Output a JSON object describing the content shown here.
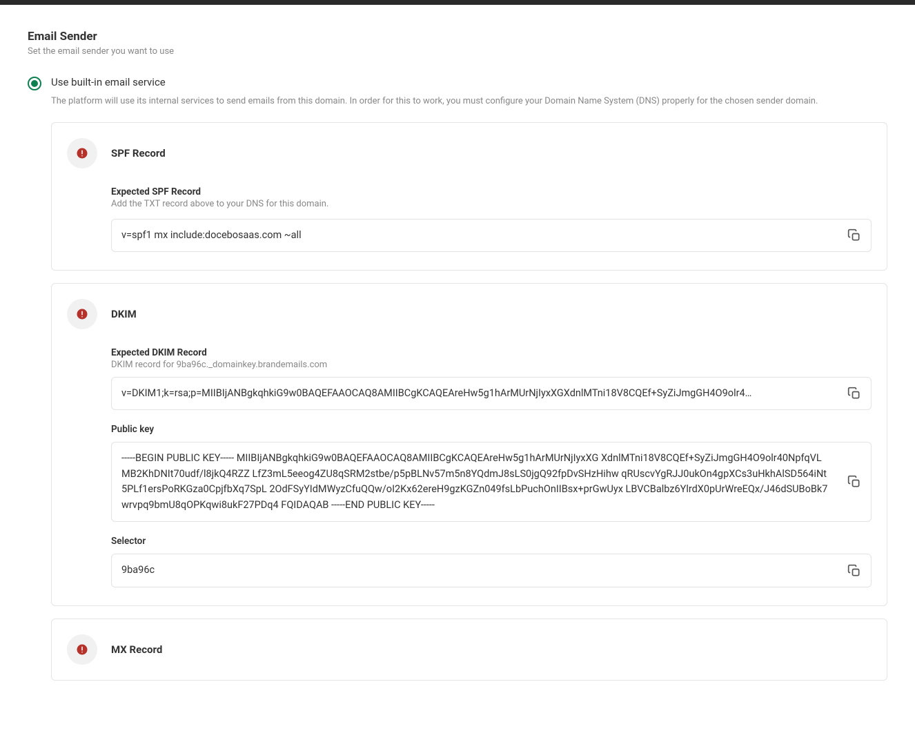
{
  "header": {
    "title": "Email Sender",
    "subtitle": "Set the email sender you want to use"
  },
  "option": {
    "label": "Use built-in email service",
    "description": "The platform will use its internal services to send emails from this domain. In order for this to work, you must configure your Domain Name System (DNS) properly for the chosen sender domain."
  },
  "spf": {
    "title": "SPF Record",
    "expected_label": "Expected SPF Record",
    "expected_hint": "Add the TXT record above to your DNS for this domain.",
    "value": "v=spf1 mx include:docebosaas.com ~all"
  },
  "dkim": {
    "title": "DKIM",
    "expected_label": "Expected DKIM Record",
    "expected_hint": "DKIM record for 9ba96c._domainkey.brandemails.com",
    "value": "v=DKIM1;k=rsa;p=MIIBIjANBgkqhkiG9w0BAQEFAAOCAQ8AMIIBCgKCAQEAreHw5g1hArMUrNjIyxXGXdnlMTni18V8CQEf+SyZiJmgGH4O9olr4…",
    "public_key_label": "Public key",
    "public_key": "-----BEGIN PUBLIC KEY----- MIIBIjANBgkqhkiG9w0BAQEFAAOCAQ8AMIIBCgKCAQEAreHw5g1hArMUrNjIyxXG XdnlMTni18V8CQEf+SyZiJmgGH4O9olr40NpfqVLMB2KhDNIt70udf/l8jkQ4RZZ LfZ3mL5eeog4ZU8qSRM2stbe/p5pBLNv57m5n8YQdmJ8sLS0jgQ92fpDvSHzHihw qRUscvYgRJJ0ukOn4gpXCs3uHkhAlSD564iNt5PLf1ersPoRKGza0CpjfbXq7SpL 2OdFSyYIdMWyzCfuQQw/oI2Kx62ereH9gzKGZn049fsLbPuchOnIIBsx+prGwUyx LBVCBalbz6YlrdX0pUrWreEQx/J46dSUBoBk7wrvpq9bmU8qOPKqwi8ukF27PDq4 FQIDAQAB -----END PUBLIC KEY-----",
    "selector_label": "Selector",
    "selector": "9ba96c"
  },
  "mx": {
    "title": "MX Record"
  },
  "icons": {
    "alert": "alert",
    "copy": "copy"
  }
}
